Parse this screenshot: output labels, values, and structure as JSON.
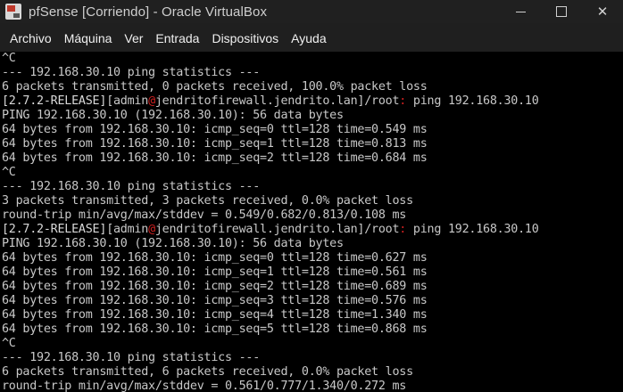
{
  "window": {
    "title": "pfSense [Corriendo] - Oracle VirtualBox",
    "icon": "virtualbox-vm-icon",
    "controls": [
      "minimize",
      "maximize",
      "close"
    ],
    "close_glyph": "✕"
  },
  "menu": {
    "items": [
      {
        "label": "Archivo"
      },
      {
        "label": "Máquina"
      },
      {
        "label": "Ver"
      },
      {
        "label": "Entrada"
      },
      {
        "label": "Dispositivos"
      },
      {
        "label": "Ayuda"
      }
    ]
  },
  "terminal": {
    "lines": [
      {
        "text": "^C"
      },
      {
        "text": "--- 192.168.30.10 ping statistics ---"
      },
      {
        "text": "6 packets transmitted, 0 packets received, 100.0% packet loss"
      },
      {
        "prompt": true,
        "release": "[2.7.2-RELEASE]",
        "user": "[admin",
        "at": "@",
        "host": "jendritofirewall.jendrito.lan]",
        "path": "/root",
        "colon": ":",
        "command": " ping 192.168.30.10"
      },
      {
        "text": "PING 192.168.30.10 (192.168.30.10): 56 data bytes"
      },
      {
        "text": "64 bytes from 192.168.30.10: icmp_seq=0 ttl=128 time=0.549 ms"
      },
      {
        "text": "64 bytes from 192.168.30.10: icmp_seq=1 ttl=128 time=0.813 ms"
      },
      {
        "text": "64 bytes from 192.168.30.10: icmp_seq=2 ttl=128 time=0.684 ms"
      },
      {
        "text": "^C"
      },
      {
        "text": "--- 192.168.30.10 ping statistics ---"
      },
      {
        "text": "3 packets transmitted, 3 packets received, 0.0% packet loss"
      },
      {
        "text": "round-trip min/avg/max/stddev = 0.549/0.682/0.813/0.108 ms"
      },
      {
        "prompt": true,
        "release": "[2.7.2-RELEASE]",
        "user": "[admin",
        "at": "@",
        "host": "jendritofirewall.jendrito.lan]",
        "path": "/root",
        "colon": ":",
        "command": " ping 192.168.30.10"
      },
      {
        "text": "PING 192.168.30.10 (192.168.30.10): 56 data bytes"
      },
      {
        "text": "64 bytes from 192.168.30.10: icmp_seq=0 ttl=128 time=0.627 ms"
      },
      {
        "text": "64 bytes from 192.168.30.10: icmp_seq=1 ttl=128 time=0.561 ms"
      },
      {
        "text": "64 bytes from 192.168.30.10: icmp_seq=2 ttl=128 time=0.689 ms"
      },
      {
        "text": "64 bytes from 192.168.30.10: icmp_seq=3 ttl=128 time=0.576 ms"
      },
      {
        "text": "64 bytes from 192.168.30.10: icmp_seq=4 ttl=128 time=1.340 ms"
      },
      {
        "text": "64 bytes from 192.168.30.10: icmp_seq=5 ttl=128 time=0.868 ms"
      },
      {
        "text": "^C"
      },
      {
        "text": "--- 192.168.30.10 ping statistics ---"
      },
      {
        "text": "6 packets transmitted, 6 packets received, 0.0% packet loss"
      },
      {
        "text": "round-trip min/avg/max/stddev = 0.561/0.777/1.340/0.272 ms"
      }
    ]
  },
  "colors": {
    "titlebar_bg": "#202020",
    "menubar_bg": "#1f1f1f",
    "terminal_bg": "#000000",
    "terminal_fg": "#c8c8c8",
    "prompt_accent": "#d02020"
  }
}
